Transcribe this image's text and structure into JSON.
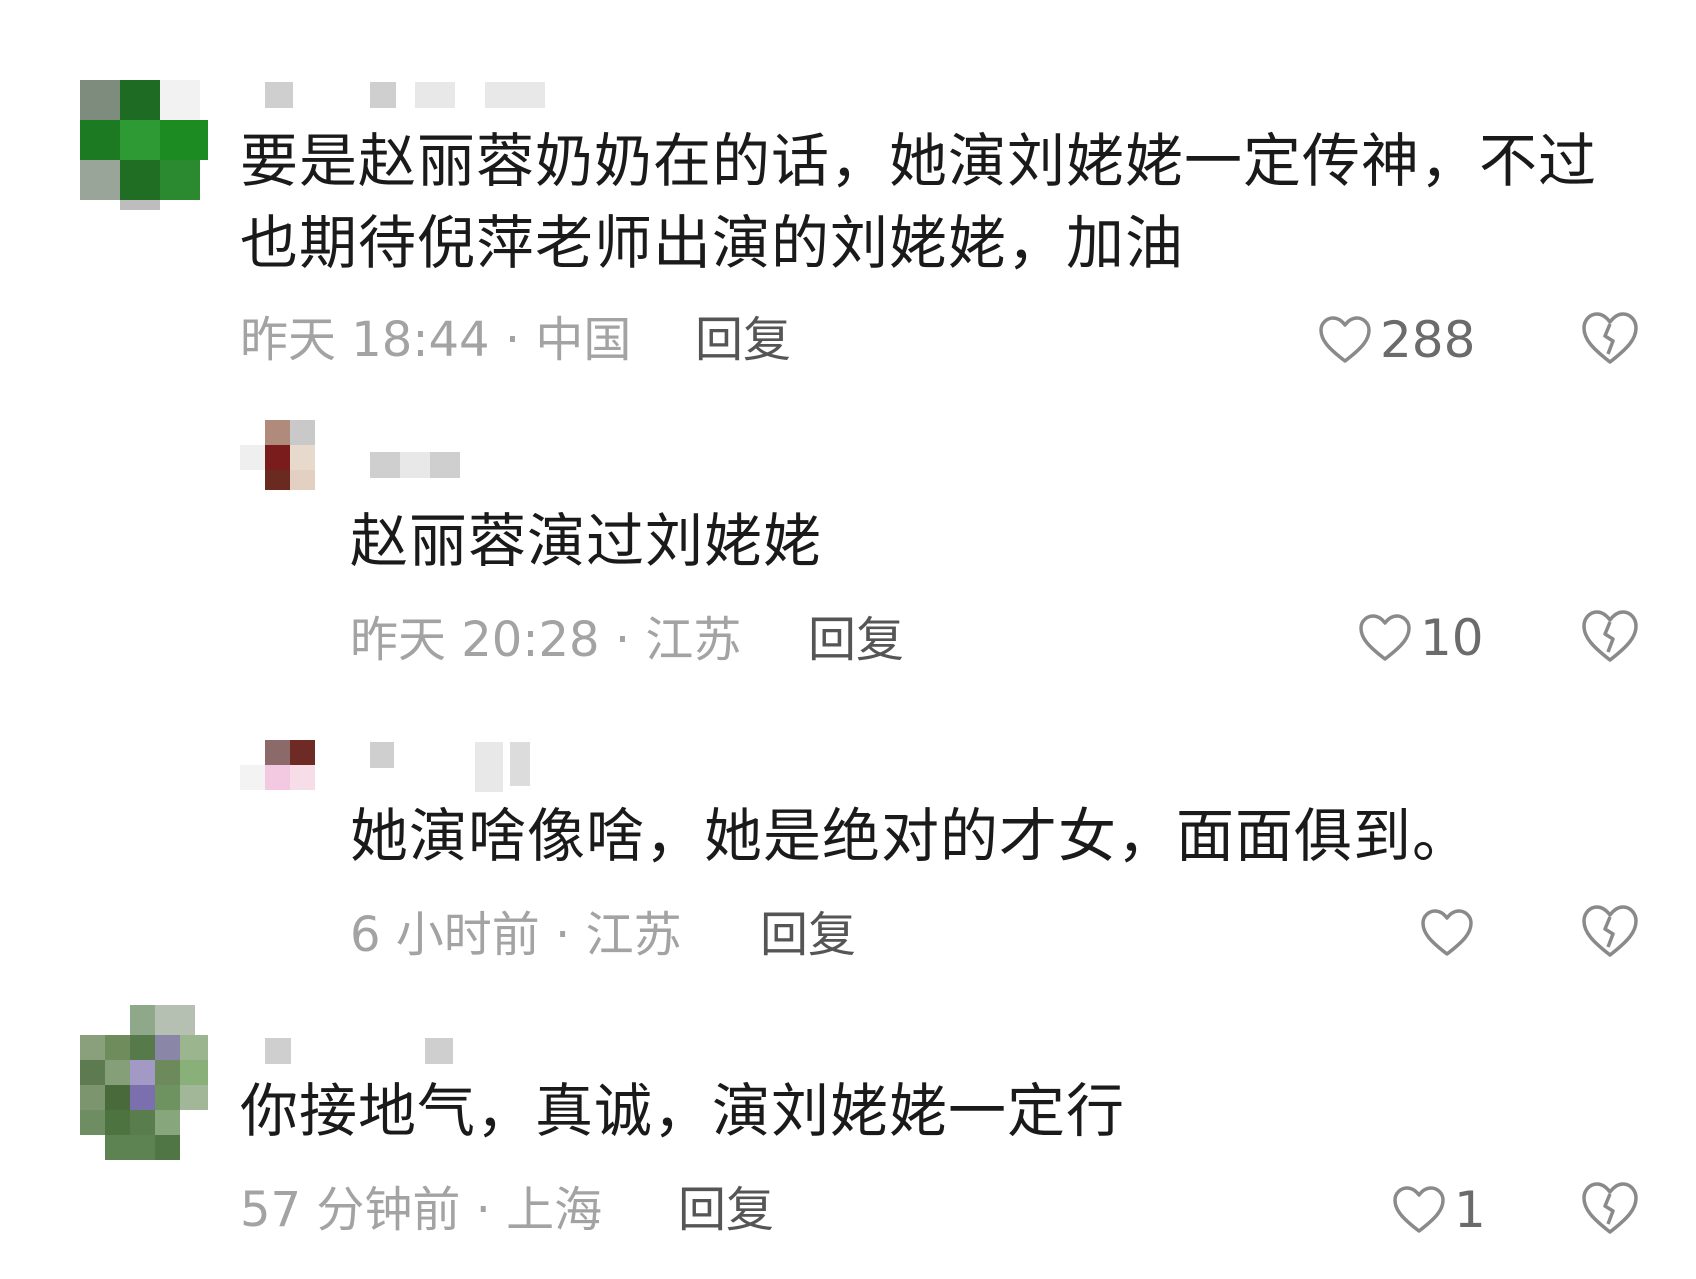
{
  "comments": [
    {
      "text_line1": "要是赵丽蓉奶奶在的话，她演刘姥姥一定传神，不过",
      "text_line2": "也期待倪萍老师出演的刘姥姥，加油",
      "time": "昨天 18:44 · 中国",
      "reply": "回复",
      "likes": "288"
    },
    {
      "text_line1": "赵丽蓉演过刘姥姥",
      "time": "昨天 20:28 · 江苏",
      "reply": "回复",
      "likes": "10"
    },
    {
      "text_line1": "她演啥像啥，她是绝对的才女，面面俱到。",
      "time": "6 小时前 · 江苏",
      "reply": "回复",
      "likes": ""
    },
    {
      "text_line1": "你接地气，真诚，演刘姥姥一定行",
      "time": "57 分钟前 · 上海",
      "reply": "回复",
      "likes": "1"
    }
  ],
  "colors": {
    "text": "#1a1a1a",
    "meta": "#a3a3a3",
    "reply": "#555555",
    "icon": "#6b6b6b"
  },
  "icons": {
    "like": "heart-icon",
    "dislike": "broken-heart-icon"
  }
}
